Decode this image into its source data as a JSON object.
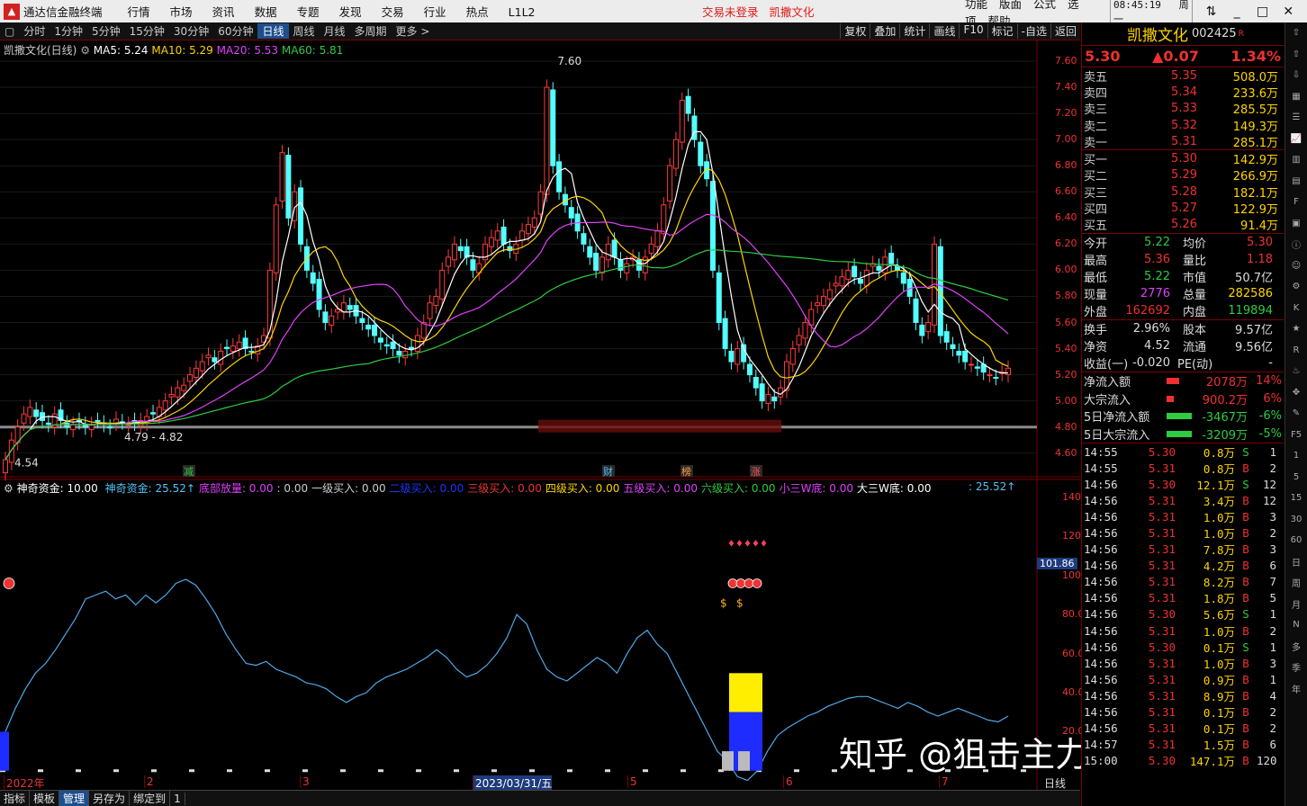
{
  "app": {
    "name": "通达信金融终端",
    "status_center": "交易未登录",
    "stock_title_center": "凯撒文化",
    "menu": [
      "行情",
      "市场",
      "资讯",
      "数据",
      "专题",
      "发现",
      "交易",
      "行业",
      "热点",
      "L1L2"
    ],
    "right_menu": [
      "功能",
      "版面",
      "公式",
      "选项",
      "帮助"
    ],
    "clock": "08:45:19",
    "weekday": "周一"
  },
  "toolbar": {
    "periods": [
      "分时",
      "1分钟",
      "5分钟",
      "15分钟",
      "30分钟",
      "60分钟",
      "日线",
      "周线",
      "月线",
      "多周期",
      "更多 >"
    ],
    "active": "日线",
    "tools": [
      "复权",
      "叠加",
      "统计",
      "画线",
      "F10",
      "标记",
      "-自选",
      "返回"
    ]
  },
  "chart_legend": {
    "title": "凯撒文化(日线)",
    "ma5": "MA5: 5.24",
    "ma10": "MA10: 5.29",
    "ma20": "MA20: 5.53",
    "ma60": "MA60: 5.81"
  },
  "chart_annotations": {
    "high": "7.60",
    "low_label": "4.54",
    "range_label": "4.79 - 4.82",
    "event_marks": [
      "减",
      "财",
      "榜",
      "涨"
    ]
  },
  "price_axis": [
    "7.60",
    "7.40",
    "7.20",
    "7.00",
    "6.80",
    "6.60",
    "6.40",
    "6.20",
    "6.00",
    "5.80",
    "5.60",
    "5.40",
    "5.20",
    "5.00",
    "4.80",
    "4.60"
  ],
  "ind_axis": [
    "140.0",
    "120.0",
    "100.0",
    "80.00",
    "60.00",
    "40.00",
    "20.00"
  ],
  "ind_cursor_value": "101.86",
  "indicator_legend": {
    "name": "神奇资金",
    "param": ": 10.00",
    "items": [
      {
        "text": "神奇资金: 25.52↑",
        "color": "#4fc3f7"
      },
      {
        "text": "底部放量: 0.00",
        "color": "#e040fb"
      },
      {
        "text": ": 0.00",
        "color": "#ccc"
      },
      {
        "text": "一级买入: 0.00",
        "color": "#ccc"
      },
      {
        "text": "二级买入: 0.00",
        "color": "#2233ff"
      },
      {
        "text": "三级买入: 0.00",
        "color": "#e33"
      },
      {
        "text": "四级买入: 0.00",
        "color": "#ffd400"
      },
      {
        "text": "五级买入: 0.00",
        "color": "#e040fb"
      },
      {
        "text": "六级买入: 0.00",
        "color": "#2ecc40"
      },
      {
        "text": "小三W底: 0.00",
        "color": "#e040fb"
      },
      {
        "text": "大三W底: 0.00",
        "color": "#fff"
      }
    ],
    "right_value": ": 25.52↑"
  },
  "date_axis": {
    "labels": [
      "2022年",
      "2",
      "3",
      "2023/03/31/五",
      "5",
      "6",
      "7"
    ],
    "period": "日线"
  },
  "bottom_tabs": [
    "指标",
    "模板",
    "管理",
    "另存为",
    "绑定到",
    "1"
  ],
  "quote": {
    "name": "凯撒文化",
    "code": "002425",
    "price": "5.30",
    "change": "▲0.07",
    "pct": "1.34%",
    "asks": [
      {
        "l": "卖五",
        "p": "5.35",
        "v": "508.0万"
      },
      {
        "l": "卖四",
        "p": "5.34",
        "v": "233.6万"
      },
      {
        "l": "卖三",
        "p": "5.33",
        "v": "285.5万"
      },
      {
        "l": "卖二",
        "p": "5.32",
        "v": "149.3万"
      },
      {
        "l": "卖一",
        "p": "5.31",
        "v": "285.1万"
      }
    ],
    "bids": [
      {
        "l": "买一",
        "p": "5.30",
        "v": "142.9万"
      },
      {
        "l": "买二",
        "p": "5.29",
        "v": "266.9万"
      },
      {
        "l": "买三",
        "p": "5.28",
        "v": "182.1万"
      },
      {
        "l": "买四",
        "p": "5.27",
        "v": "122.9万"
      },
      {
        "l": "买五",
        "p": "5.26",
        "v": "91.4万"
      }
    ],
    "stats1": [
      {
        "k": "今开",
        "v": "5.22",
        "vc": "#2ecc40",
        "k2": "均价",
        "v2": "5.30",
        "v2c": "#f03030"
      },
      {
        "k": "最高",
        "v": "5.36",
        "vc": "#f03030",
        "k2": "量比",
        "v2": "1.18",
        "v2c": "#f03030"
      },
      {
        "k": "最低",
        "v": "5.22",
        "vc": "#2ecc40",
        "k2": "市值",
        "v2": "50.7亿",
        "v2c": "#ddd"
      },
      {
        "k": "现量",
        "v": "2776",
        "vc": "#e040fb",
        "k2": "总量",
        "v2": "282586",
        "v2c": "#ffd400"
      },
      {
        "k": "外盘",
        "v": "162692",
        "vc": "#f03030",
        "k2": "内盘",
        "v2": "119894",
        "v2c": "#2ecc40"
      }
    ],
    "stats2": [
      {
        "k": "换手",
        "v": "2.96%",
        "vc": "#ddd",
        "k2": "股本",
        "v2": "9.57亿",
        "v2c": "#ddd"
      },
      {
        "k": "净资",
        "v": "4.52",
        "vc": "#ddd",
        "k2": "流通",
        "v2": "9.56亿",
        "v2c": "#ddd"
      },
      {
        "k": "收益(一)",
        "v": "-0.020",
        "vc": "#ddd",
        "k2": "PE(动)",
        "v2": "-",
        "v2c": "#ddd"
      }
    ],
    "flows": [
      {
        "k": "净流入额",
        "v": "2078万",
        "p": "14%",
        "c": "#f03030",
        "barc": "#f03030"
      },
      {
        "k": "大宗流入",
        "v": "900.2万",
        "p": "6%",
        "c": "#f03030",
        "barc": "#f03030"
      },
      {
        "k": "5日净流入额",
        "v": "-3467万",
        "p": "-6%",
        "c": "#2ecc40",
        "barc": "#2ecc40"
      },
      {
        "k": "5日大宗流入",
        "v": "-3209万",
        "p": "-5%",
        "c": "#2ecc40",
        "barc": "#2ecc40"
      }
    ],
    "ticks": [
      [
        "14:55",
        "5.30",
        "0.8万",
        "S",
        "1"
      ],
      [
        "14:55",
        "5.31",
        "0.8万",
        "B",
        "2"
      ],
      [
        "14:56",
        "5.30",
        "12.1万",
        "S",
        "12"
      ],
      [
        "14:56",
        "5.31",
        "3.4万",
        "B",
        "12"
      ],
      [
        "14:56",
        "5.31",
        "1.0万",
        "B",
        "3"
      ],
      [
        "14:56",
        "5.31",
        "1.0万",
        "B",
        "2"
      ],
      [
        "14:56",
        "5.31",
        "7.8万",
        "B",
        "3"
      ],
      [
        "14:56",
        "5.31",
        "4.2万",
        "B",
        "6"
      ],
      [
        "14:56",
        "5.31",
        "8.2万",
        "B",
        "7"
      ],
      [
        "14:56",
        "5.31",
        "1.8万",
        "B",
        "5"
      ],
      [
        "14:56",
        "5.30",
        "5.6万",
        "S",
        "1"
      ],
      [
        "14:56",
        "5.31",
        "1.0万",
        "B",
        "2"
      ],
      [
        "14:56",
        "5.30",
        "0.1万",
        "S",
        "1"
      ],
      [
        "14:56",
        "5.31",
        "1.0万",
        "B",
        "3"
      ],
      [
        "14:56",
        "5.31",
        "0.9万",
        "B",
        "1"
      ],
      [
        "14:56",
        "5.31",
        "8.9万",
        "B",
        "4"
      ],
      [
        "14:56",
        "5.31",
        "0.1万",
        "B",
        "2"
      ],
      [
        "14:56",
        "5.31",
        "0.1万",
        "B",
        "2"
      ],
      [
        "14:57",
        "5.31",
        "1.5万",
        "B",
        "6"
      ],
      [
        "15:00",
        "5.30",
        "147.1万",
        "B",
        "120"
      ]
    ]
  },
  "sidebar_icons": [
    "arrow-up-icon",
    "arrow-up-icon",
    "arrow-down-icon",
    "grid-icon",
    "list-icon",
    "chart-icon",
    "bars-icon",
    "table-icon",
    "f10-icon",
    "doc-icon",
    "info-icon",
    "people-icon",
    "gear-icon",
    "k-icon",
    "star-icon",
    "rsi-icon",
    "fire-icon",
    "move-icon",
    "draw-icon",
    "f5-icon",
    "1",
    "5",
    "15",
    "30",
    "60",
    "日",
    "周",
    "月",
    "N",
    "多",
    "季",
    "年"
  ],
  "watermark": "知乎 @狙击主力训练营长",
  "chart_data": {
    "type": "candlestick",
    "price_ylim": [
      4.5,
      7.7
    ],
    "ma_last": {
      "MA5": 5.24,
      "MA10": 5.29,
      "MA20": 5.53,
      "MA60": 5.81
    },
    "high": 7.6,
    "low": 4.54,
    "indicator": {
      "name": "神奇资金",
      "ylim": [
        0,
        150
      ],
      "last": 25.52
    }
  }
}
